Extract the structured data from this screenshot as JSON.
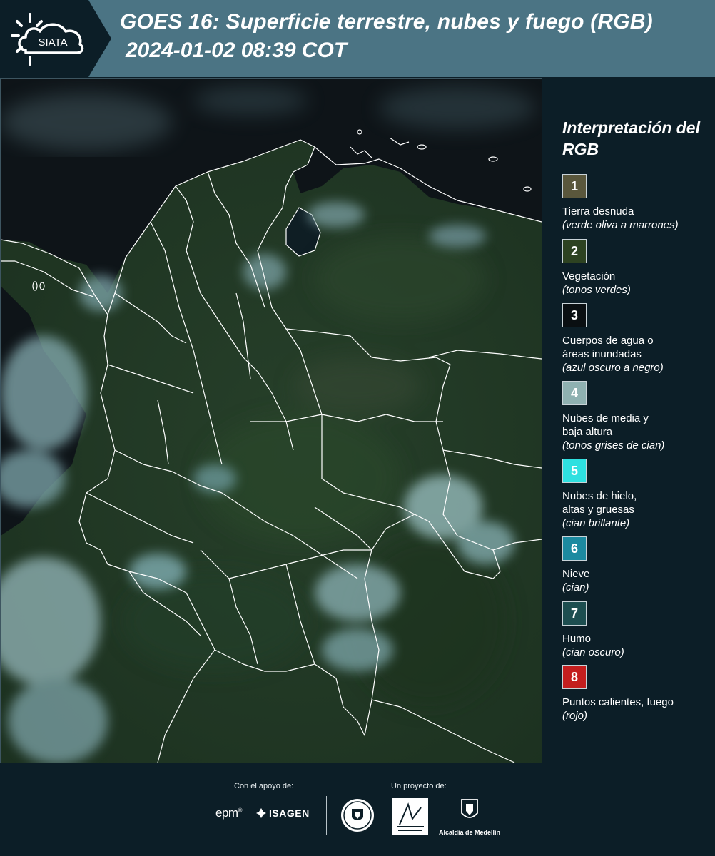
{
  "header": {
    "title_line1": "GOES 16: Superficie terrestre, nubes y fuego (RGB)",
    "title_line2": "2024-01-02 08:39 COT",
    "logo_text": "SIATA",
    "logo_icon": "sun-cloud-icon"
  },
  "legend": {
    "title": "Interpretación del RGB",
    "items": [
      {
        "number": "1",
        "label": "Tierra desnuda",
        "sub": "(verde oliva a marrones)",
        "color": "#5a573c"
      },
      {
        "number": "2",
        "label": "Vegetación",
        "sub": "(tonos verdes)",
        "color": "#2d4221"
      },
      {
        "number": "3",
        "label": "Cuerpos de agua o áreas inundadas",
        "sub": "(azul oscuro a negro)",
        "color": "#0a0f12"
      },
      {
        "number": "4",
        "label": "Nubes de media y baja altura",
        "sub": "(tonos grises de cian)",
        "color": "#8fb1b1"
      },
      {
        "number": "5",
        "label": "Nubes de hielo, altas y gruesas",
        "sub": "(cian brillante)",
        "color": "#2ee0e0"
      },
      {
        "number": "6",
        "label": "Nieve",
        "sub": "(cian)",
        "color": "#1c8aa0"
      },
      {
        "number": "7",
        "label": "Humo",
        "sub": "(cian oscuro)",
        "color": "#1d4e50"
      },
      {
        "number": "8",
        "label": "Puntos calientes, fuego",
        "sub": "(rojo)",
        "color": "#c41e1e"
      }
    ]
  },
  "footer": {
    "support_label": "Con el apoyo de:",
    "project_label": "Un proyecto de:",
    "sponsor1": "epm",
    "sponsor2": "ISAGEN",
    "partner_alcaldia": "Alcaldía de Medellín"
  },
  "colors": {
    "header_bg": "#4b7484",
    "panel_bg": "#0c1e27",
    "land": "#243a26",
    "ocean": "#0e1418",
    "cloud": "#8fb7bb"
  }
}
